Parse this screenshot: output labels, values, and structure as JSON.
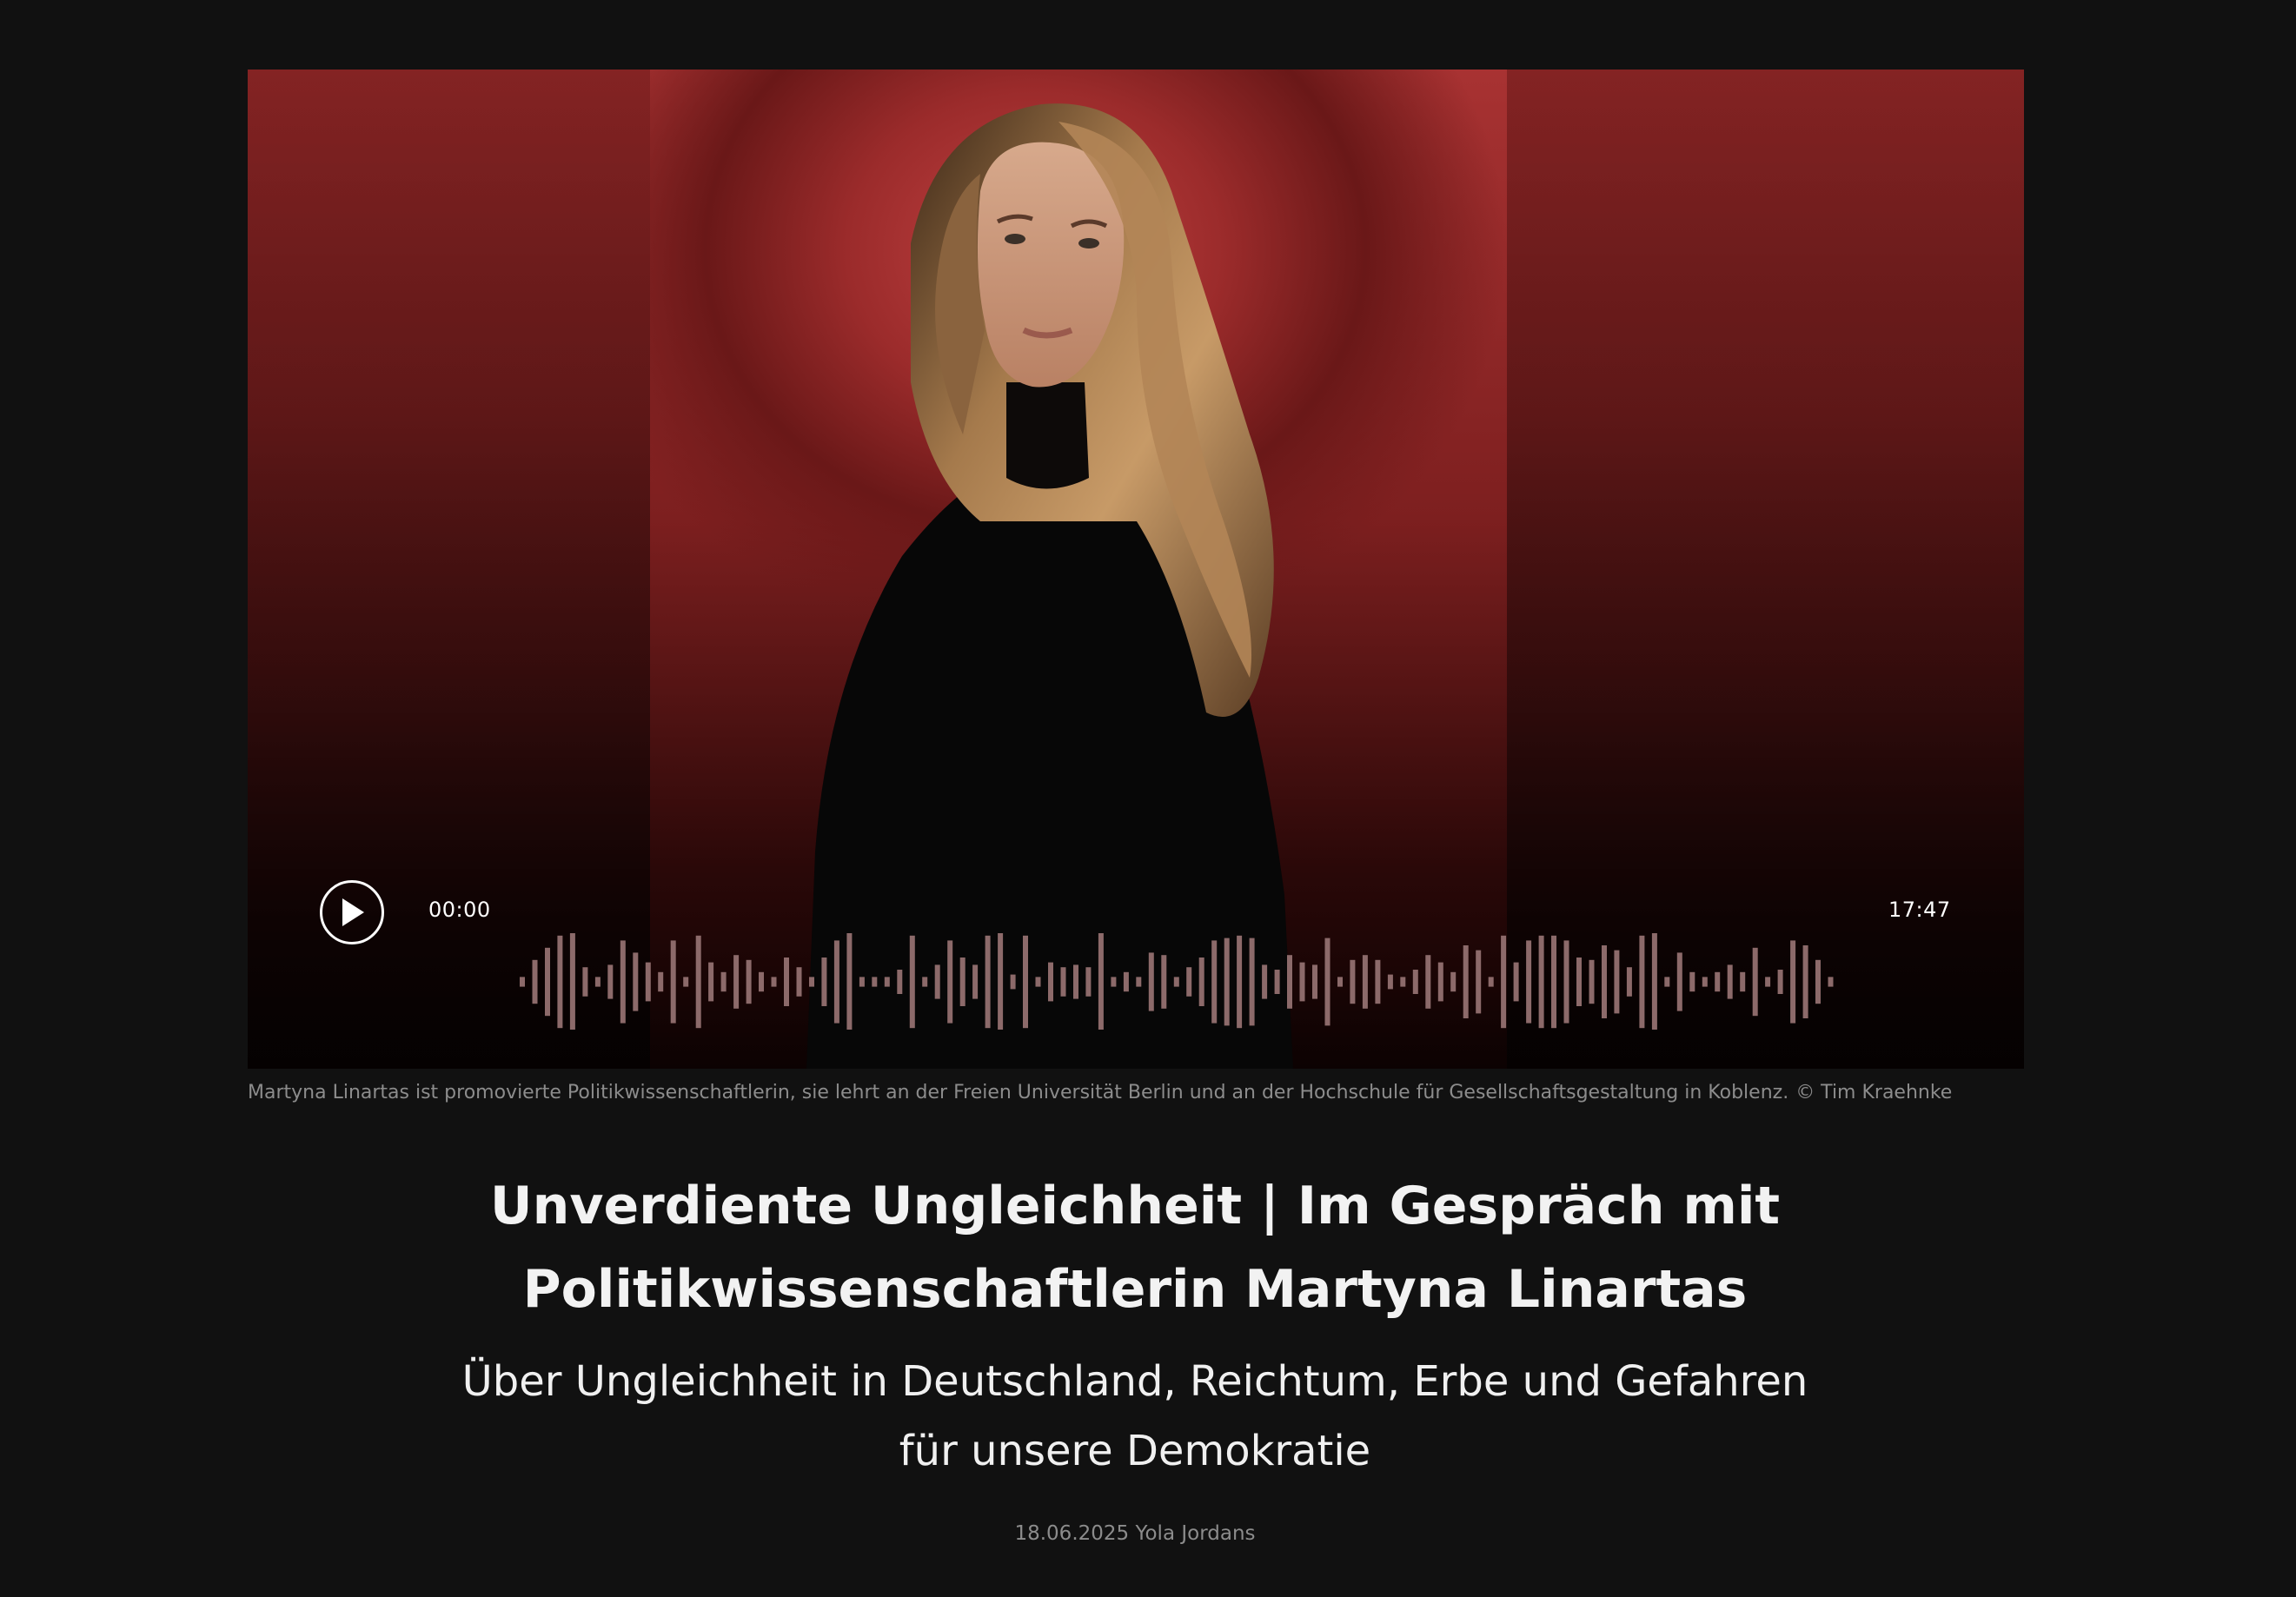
{
  "player": {
    "current_time": "00:00",
    "duration": "17:47",
    "play_icon": "play-icon",
    "waveform_bars": [
      0.1,
      0.45,
      0.7,
      0.95,
      1.0,
      0.3,
      0.1,
      0.35,
      0.85,
      0.6,
      0.4,
      0.2,
      0.85,
      0.1,
      0.95,
      0.4,
      0.2,
      0.55,
      0.45,
      0.2,
      0.1,
      0.5,
      0.3,
      0.1,
      0.5,
      0.85,
      1.0,
      0.1,
      0.1,
      0.1,
      0.25,
      0.95,
      0.1,
      0.35,
      0.85,
      0.5,
      0.35,
      0.95,
      1.0,
      0.15,
      0.95,
      0.1,
      0.4,
      0.3,
      0.35,
      0.3,
      1.0,
      0.1,
      0.2,
      0.1,
      0.6,
      0.55,
      0.1,
      0.3,
      0.5,
      0.85,
      0.9,
      0.95,
      0.9,
      0.35,
      0.25,
      0.55,
      0.4,
      0.35,
      0.9,
      0.1,
      0.45,
      0.55,
      0.45,
      0.15,
      0.1,
      0.25,
      0.55,
      0.4,
      0.2,
      0.75,
      0.65,
      0.1,
      0.95,
      0.4,
      0.85,
      0.95,
      0.95,
      0.85,
      0.5,
      0.45,
      0.75,
      0.65,
      0.3,
      0.95,
      1.0,
      0.1,
      0.6,
      0.2,
      0.1,
      0.2,
      0.35,
      0.2,
      0.7,
      0.1,
      0.25,
      0.85,
      0.75,
      0.45,
      0.1
    ],
    "waveform_color": "#8c6a6a"
  },
  "caption": {
    "text": "Martyna Linartas ist promovierte Politikwissenschaftlerin, sie lehrt an der Freien Universität Berlin und an der Hochschule für Gesellschaftsgestaltung in Koblenz.",
    "credit": "© Tim Kraehnke"
  },
  "article": {
    "title_line1": "Unverdiente Ungleichheit | Im Gespräch mit",
    "title_line2": "Politikwissenschaftlerin Martyna Linartas",
    "subtitle_line1": "Über Ungleichheit in Deutschland, Reichtum, Erbe und Gefahren",
    "subtitle_line2": "für unsere Demokratie",
    "date": "18.06.2025",
    "author": "Yola Jordans"
  },
  "colors": {
    "background": "#111111",
    "accent_red": "#9b2b2b"
  }
}
